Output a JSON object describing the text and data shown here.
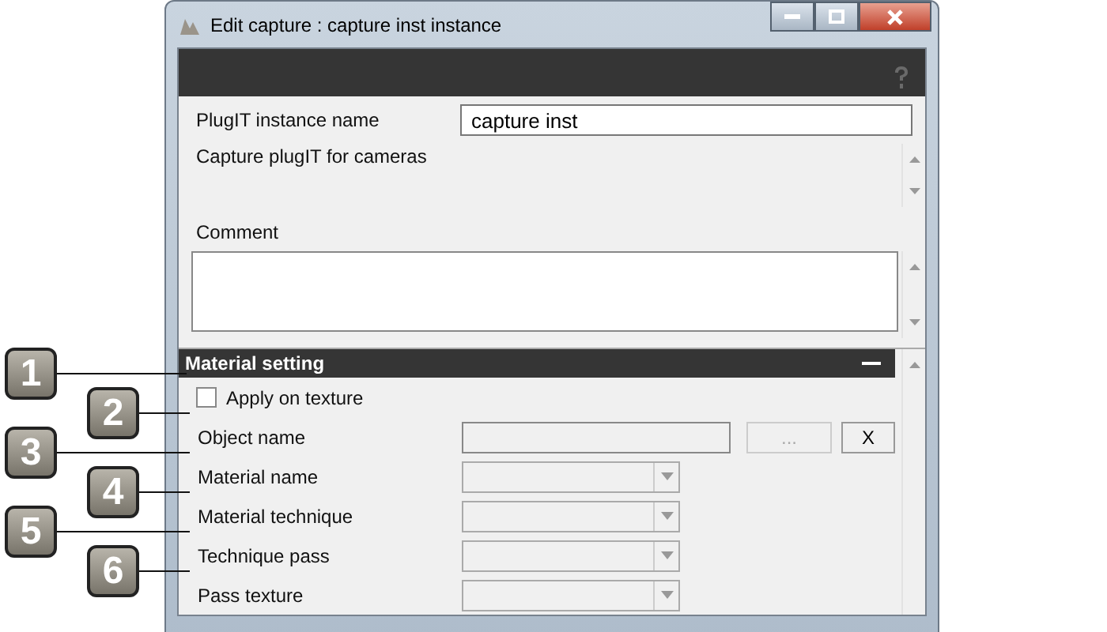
{
  "window": {
    "title": "Edit capture : capture inst instance"
  },
  "instance_name": {
    "label": "PlugIT instance name",
    "value": "capture inst"
  },
  "description": "Capture plugIT for cameras",
  "comment": {
    "label": "Comment"
  },
  "material_section": {
    "title": "Material setting",
    "expanded": true,
    "rows": [
      {
        "kind": "checkbox",
        "label": "Apply on texture",
        "checked": false
      },
      {
        "kind": "text",
        "label": "Object name",
        "buttons": [
          {
            "label": "...",
            "disabled": true
          },
          {
            "label": "X",
            "disabled": false
          }
        ]
      },
      {
        "kind": "select",
        "label": "Material name",
        "disabled": true
      },
      {
        "kind": "select",
        "label": "Material technique",
        "disabled": true
      },
      {
        "kind": "select",
        "label": "Technique pass",
        "disabled": true
      },
      {
        "kind": "select",
        "label": "Pass texture",
        "disabled": true
      }
    ]
  },
  "callouts": [
    "1",
    "2",
    "3",
    "4",
    "5",
    "6"
  ]
}
